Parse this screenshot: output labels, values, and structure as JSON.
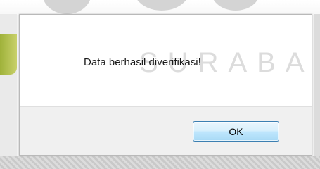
{
  "dialog": {
    "message": "Data berhasil diverifikasi!",
    "ok_label": "OK"
  },
  "background": {
    "watermark_text": "SURABA"
  }
}
